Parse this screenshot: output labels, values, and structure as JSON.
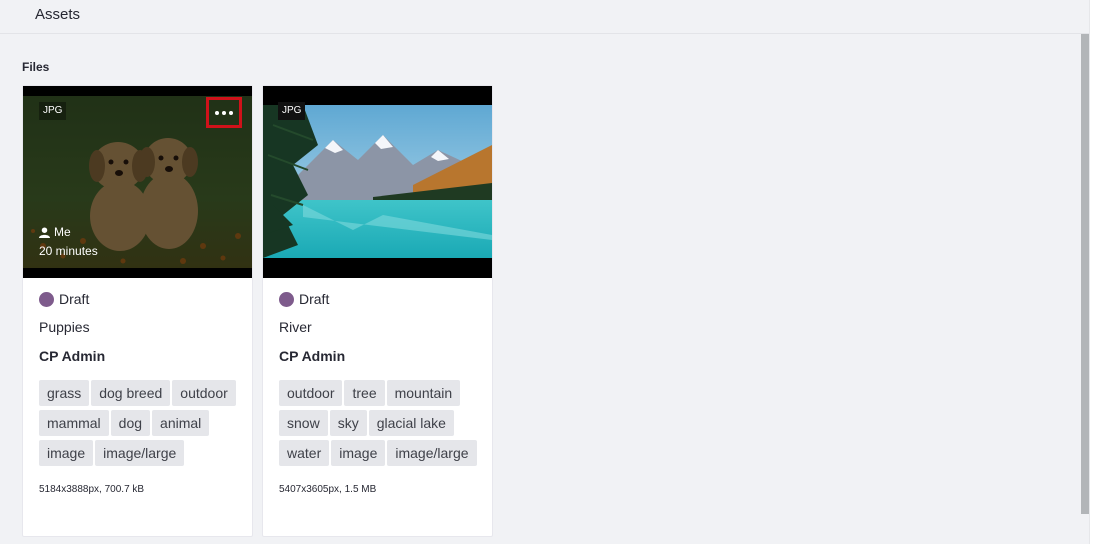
{
  "header": {
    "title": "Assets"
  },
  "section": {
    "title": "Files"
  },
  "cards": [
    {
      "file_type": "JPG",
      "owner": "Me",
      "age": "20 minutes",
      "status": "Draft",
      "status_color": "#7e5b8c",
      "title": "Puppies",
      "author": "CP Admin",
      "tags": [
        "grass",
        "dog breed",
        "outdoor",
        "mammal",
        "dog",
        "animal",
        "image",
        "image/large"
      ],
      "dimensions": "5184x3888px, 700.7 kB"
    },
    {
      "file_type": "JPG",
      "status": "Draft",
      "status_color": "#7e5b8c",
      "title": "River",
      "author": "CP Admin",
      "tags": [
        "outdoor",
        "tree",
        "mountain",
        "snow",
        "sky",
        "glacial lake",
        "water",
        "image",
        "image/large"
      ],
      "dimensions": "5407x3605px, 1.5 MB"
    }
  ],
  "colors": {
    "highlight": "#d0121a",
    "tag_bg": "#e5e6ea",
    "page_bg": "#f1f2f5"
  },
  "icons": {
    "more": "ellipsis-icon",
    "owner": "user-icon"
  }
}
